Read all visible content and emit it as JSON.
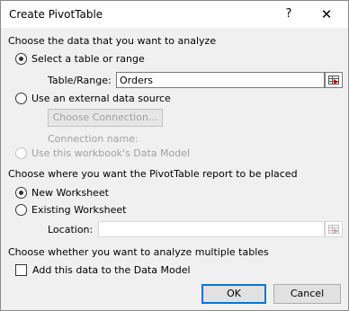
{
  "window": {
    "title": "Create PivotTable",
    "help_glyph": "?",
    "close_glyph": "✕"
  },
  "data_source": {
    "heading": "Choose the data that you want to analyze",
    "select_range_label": "Select a table or range",
    "table_range_label": "Table/Range:",
    "table_range_value": "Orders",
    "external_label": "Use an external data source",
    "choose_connection_label": "Choose Connection...",
    "connection_name_label": "Connection name:",
    "data_model_label": "Use this workbook's Data Model"
  },
  "placement": {
    "heading": "Choose where you want the PivotTable report to be placed",
    "new_worksheet_label": "New Worksheet",
    "existing_worksheet_label": "Existing Worksheet",
    "location_label": "Location:",
    "location_value": ""
  },
  "multiple_tables": {
    "heading": "Choose whether you want to analyze multiple tables",
    "add_to_model_label": "Add this data to the Data Model"
  },
  "buttons": {
    "ok_label": "OK",
    "cancel_label": "Cancel"
  },
  "state": {
    "select_range_checked": true,
    "external_checked": false,
    "new_worksheet_checked": true,
    "existing_worksheet_checked": false,
    "add_to_model_checked": false
  },
  "icons": {
    "range_picker": "collapse-dialog-icon"
  },
  "colors": {
    "accent": "#0078d7",
    "dialog_bg": "#f0f0f0",
    "disabled_text": "#a0a0a0"
  }
}
